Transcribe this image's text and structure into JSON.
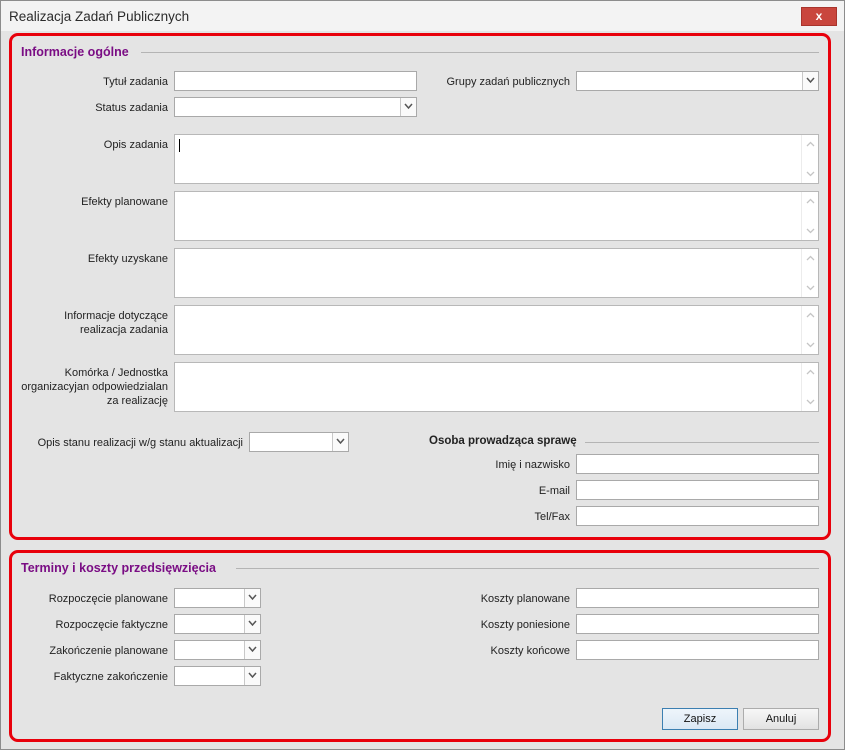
{
  "window": {
    "title": "Realizacja Zadań Publicznych",
    "close_label": "x"
  },
  "general": {
    "title": "Informacje ogólne",
    "task_title_label": "Tytuł zadania",
    "task_title_value": "",
    "task_groups_label": "Grupy zadań publicznych",
    "task_groups_value": "",
    "task_status_label": "Status zadania",
    "task_status_value": "",
    "task_description_label": "Opis zadania",
    "planned_effects_label": "Efekty planowane",
    "achieved_effects_label": "Efekty uzyskane",
    "implementation_info_label": [
      "Informacje dotyczące",
      "realizacja zadania"
    ],
    "organizational_unit_label": [
      "Komórka / Jednostka",
      "organizacyjan odpowiedzialan",
      "za realizację"
    ],
    "status_description_label": "Opis stanu realizacji w/g stanu aktualizacji",
    "status_description_value": ""
  },
  "contact": {
    "title": "Osoba prowadząca sprawę",
    "name_label": "Imię i nazwisko",
    "email_label": "E-mail",
    "phone_label": "Tel/Fax"
  },
  "schedule": {
    "title": "Terminy i koszty przedsięwzięcia",
    "planned_start_label": "Rozpoczęcie planowane",
    "actual_start_label": "Rozpoczęcie faktyczne",
    "planned_end_label": "Zakończenie planowane",
    "actual_end_label": "Faktyczne zakończenie",
    "planned_costs_label": "Koszty planowane",
    "incurred_costs_label": "Koszty poniesione",
    "final_costs_label": "Koszty końcowe"
  },
  "buttons": {
    "save_label": "Zapisz",
    "cancel_label": "Anuluj"
  },
  "colors": {
    "highlight_border": "#e8000b",
    "section_title": "#7a0d84"
  }
}
